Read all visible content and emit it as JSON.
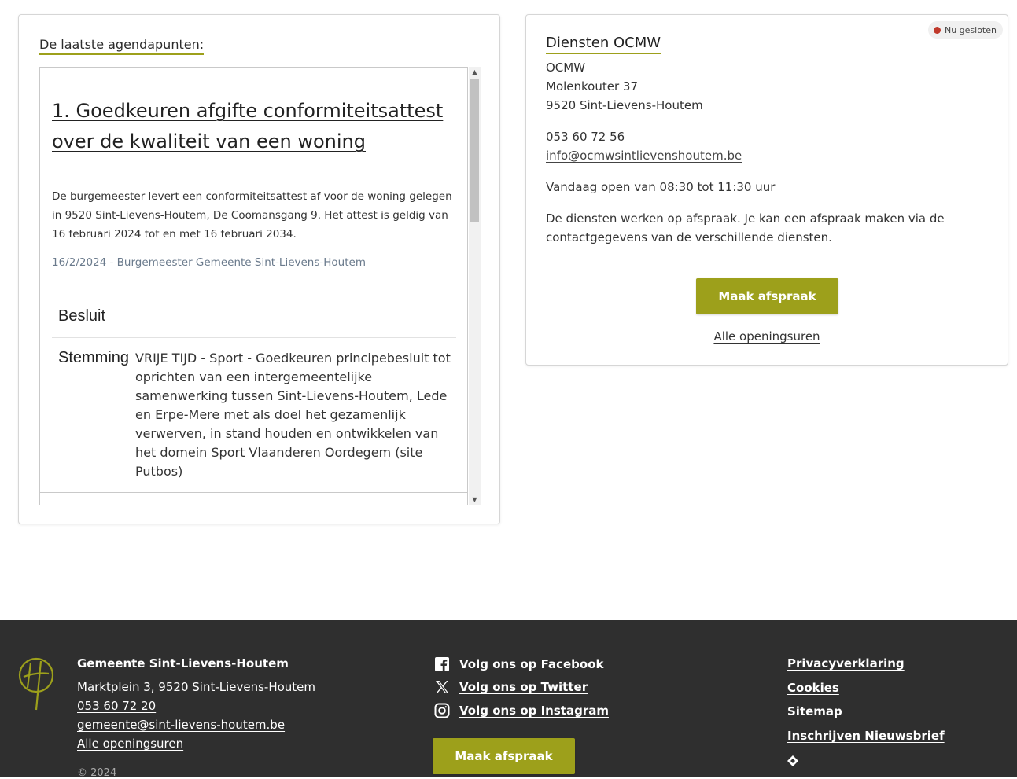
{
  "agenda": {
    "heading": "De laatste agendapunten:",
    "item": {
      "title": "1. Goedkeuren afgifte conformiteitsattest over de kwaliteit van een woning",
      "description": "De burgemeester levert een conformiteitsattest af voor de woning gelegen in 9520 Sint-Lievens-Houtem, De Coomansgang 9. Het attest is geldig van 16 februari 2024 tot en met 16 februari 2034.",
      "meta": "16/2/2024 - Burgemeester Gemeente Sint-Lievens-Houtem",
      "besluit_label": "Besluit",
      "stemming_label": "Stemming",
      "stemming_text": "VRIJE TIJD - Sport - Goedkeuren principebesluit tot oprichten van een intergemeentelijke samenwerking tussen Sint-Lievens-Houtem, Lede en Erpe-Mere met als doel het gezamenlijk verwerven, in stand houden en ontwikkelen van het domein Sport Vlaanderen Oordegem (site Putbos)"
    }
  },
  "ocmw": {
    "status": "Nu gesloten",
    "title": "Diensten OCMW",
    "name": "OCMW",
    "street": "Molenkouter 37",
    "city": "9520 Sint-Lievens-Houtem",
    "phone": "053 60 72 56",
    "email": "info@ocmwsintlievenshoutem.be",
    "today_hours": "Vandaag open van 08:30 tot 11:30 uur",
    "note": "De diensten werken op afspraak. Je kan een afspraak maken via de contactgegevens van de verschillende diensten.",
    "button_label": "Maak afspraak",
    "hours_link": "Alle openingsuren"
  },
  "footer": {
    "org_name": "Gemeente Sint-Lievens-Houtem",
    "address": "Marktplein 3,  9520 Sint-Lievens-Houtem",
    "phone": "053 60 72 20",
    "email": "gemeente@sint-lievens-houtem.be",
    "hours_link": "Alle openingsuren",
    "copyright": "© 2024",
    "social": [
      {
        "icon": "facebook-icon",
        "label": "Volg ons op Facebook"
      },
      {
        "icon": "x-twitter-icon",
        "label": "Volg ons op Twitter"
      },
      {
        "icon": "instagram-icon",
        "label": "Volg ons op Instagram"
      }
    ],
    "button_label": "Maak afspraak",
    "links": [
      "Privacyverklaring",
      "Cookies",
      "Sitemap",
      "Inschrijven Nieuwsbrief"
    ]
  },
  "colors": {
    "accent_green": "#9da01b",
    "status_red": "#c0392b",
    "footer_bg": "#2f2f2f"
  }
}
